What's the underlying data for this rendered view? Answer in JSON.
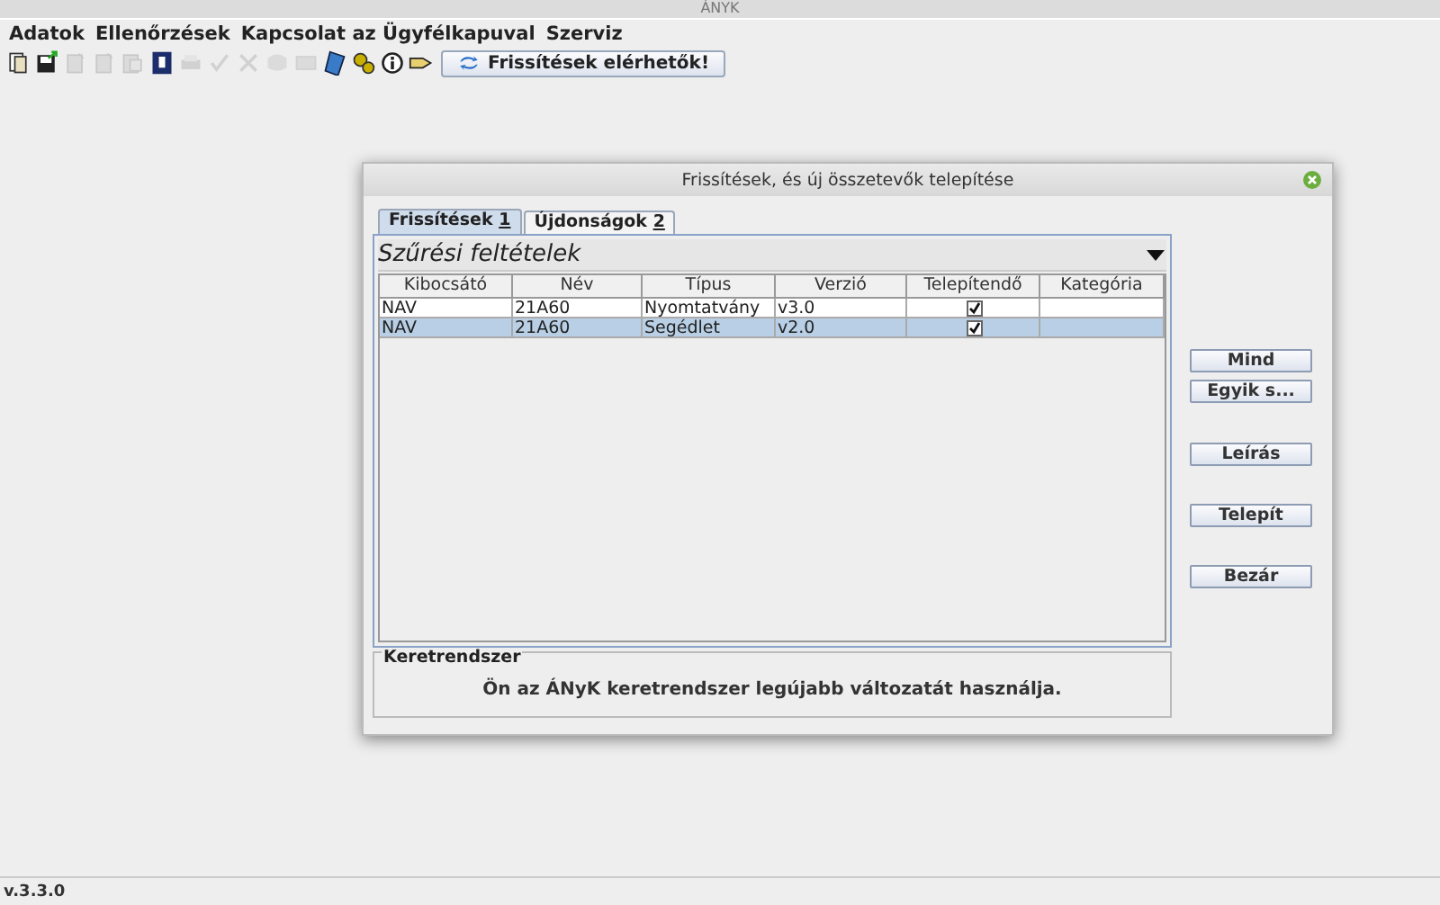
{
  "app_title": "ÁNYK",
  "menu": [
    "Adatok",
    "Ellenőrzések",
    "Kapcsolat az Ügyfélkapuval",
    "Szerviz"
  ],
  "toolbar": [
    {
      "disabled": false
    },
    {
      "disabled": false
    },
    {
      "disabled": true
    },
    {
      "disabled": true
    },
    {
      "disabled": true
    },
    {
      "disabled": false
    },
    {
      "disabled": true
    },
    {
      "disabled": true
    },
    {
      "disabled": true
    },
    {
      "disabled": true
    },
    {
      "disabled": true
    },
    {
      "disabled": false
    },
    {
      "disabled": false
    },
    {
      "disabled": false
    },
    {
      "disabled": false
    }
  ],
  "update_button": "Frissítések elérhetők!",
  "dialog": {
    "title": "Frissítések, és új összetevők telepítése",
    "tabs": [
      {
        "label": "Frissítések",
        "mnemonic": "1",
        "selected": true
      },
      {
        "label": "Újdonságok",
        "mnemonic": "2",
        "selected": false
      }
    ],
    "filter": "Szűrési feltételek",
    "columns": [
      "Kibocsátó",
      "Név",
      "Típus",
      "Verzió",
      "Telepítendő",
      "Kategória"
    ],
    "rows": [
      {
        "issuer": "NAV",
        "name": "21A60",
        "type": "Nyomtatvány",
        "version": "v3.0",
        "install": true,
        "selected": false
      },
      {
        "issuer": "NAV",
        "name": "21A60",
        "type": "Segédlet",
        "version": "v2.0",
        "install": true,
        "selected": true
      }
    ],
    "buttons": [
      "Mind",
      "Egyik s...",
      "Leírás",
      "Telepít",
      "Bezár"
    ],
    "group_title": "Keretrendszer",
    "group_message": "Ön az ÁNyK keretrendszer legújabb változatát használja."
  },
  "version": "v.3.3.0"
}
